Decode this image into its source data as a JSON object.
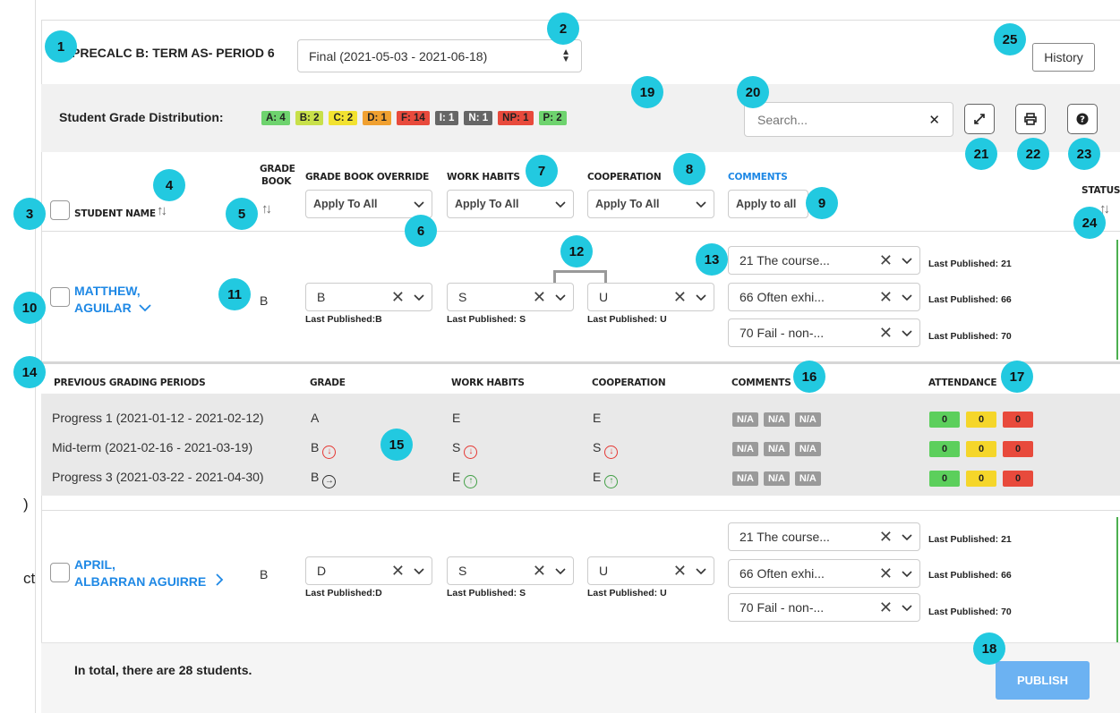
{
  "left_panel": {
    "fragments": [
      ")",
      "ct"
    ]
  },
  "header": {
    "course_title": "PRECALC B: TERM AS- PERIOD 6",
    "term_select": "Final (2021-05-03 - 2021-06-18)",
    "history_label": "History"
  },
  "distribution": {
    "label": "Student Grade Distribution:",
    "badges": [
      {
        "text": "A: 4",
        "color": "#6ed36e"
      },
      {
        "text": "B: 2",
        "color": "#c8e04a"
      },
      {
        "text": "C: 2",
        "color": "#f2e230"
      },
      {
        "text": "D: 1",
        "color": "#f0a030"
      },
      {
        "text": "F: 14",
        "color": "#e84a3c"
      },
      {
        "text": "I: 1",
        "color": "#666666"
      },
      {
        "text": "N: 1",
        "color": "#666666"
      },
      {
        "text": "NP: 1",
        "color": "#e84a3c"
      },
      {
        "text": "P: 2",
        "color": "#6ed36e"
      }
    ]
  },
  "search": {
    "placeholder": "Search...",
    "clear": "✕"
  },
  "toolbar_icons": [
    "expand-icon",
    "print-icon",
    "help-icon"
  ],
  "columns": {
    "student_name": "STUDENT NAME",
    "grade_book_1": "GRADE",
    "grade_book_2": "BOOK",
    "override": "GRADE BOOK OVERRIDE",
    "work_habits": "WORK HABITS",
    "cooperation": "COOPERATION",
    "comments": "COMMENTS",
    "status": "STATUS",
    "apply_all": "Apply To All",
    "apply_all_comments": "Apply to all"
  },
  "students": [
    {
      "last": "MATTHEW,",
      "first": "AGUILAR",
      "gradebook": "B",
      "override": "B",
      "override_pub": "Last Published:B",
      "work_habits": "S",
      "work_pub": "Last Published: S",
      "cooperation": "U",
      "coop_pub": "Last Published: U",
      "comments": [
        "21 The course...",
        "66 Often exhi...",
        "70 Fail - non-..."
      ],
      "comment_pubs": [
        "Last Published: 21",
        "Last Published: 66",
        "Last Published: 70"
      ]
    },
    {
      "last": "APRIL,",
      "first": "ALBARRAN AGUIRRE",
      "gradebook": "B",
      "override": "D",
      "override_pub": "Last Published:D",
      "work_habits": "S",
      "work_pub": "Last Published: S",
      "cooperation": "U",
      "coop_pub": "Last Published: U",
      "comments": [
        "21 The course...",
        "66 Often exhi...",
        "70 Fail - non-..."
      ],
      "comment_pubs": [
        "Last Published: 21",
        "Last Published: 66",
        "Last Published: 70"
      ]
    }
  ],
  "previous": {
    "headers": [
      "PREVIOUS GRADING PERIODS",
      "GRADE",
      "WORK HABITS",
      "COOPERATION",
      "COMMENTS",
      "ATTENDANCE"
    ],
    "rows": [
      {
        "period": "Progress 1 (2021-01-12 - 2021-02-12)",
        "grade": "A",
        "work": "E",
        "coop": "E"
      },
      {
        "period": "Mid-term (2021-02-16 - 2021-03-19)",
        "grade": "B",
        "work": "S",
        "coop": "S"
      },
      {
        "period": "Progress 3 (2021-03-22 - 2021-04-30)",
        "grade": "B",
        "work": "E",
        "coop": "E"
      }
    ],
    "na": "N/A",
    "attendance": [
      "0",
      "0",
      "0"
    ]
  },
  "footer": {
    "total": "In total, there are 28 students.",
    "publish": "PUBLISH"
  },
  "markers": [
    "1",
    "2",
    "3",
    "4",
    "5",
    "6",
    "7",
    "8",
    "9",
    "10",
    "11",
    "12",
    "13",
    "14",
    "15",
    "16",
    "17",
    "18",
    "19",
    "20",
    "21",
    "22",
    "23",
    "24",
    "25"
  ]
}
